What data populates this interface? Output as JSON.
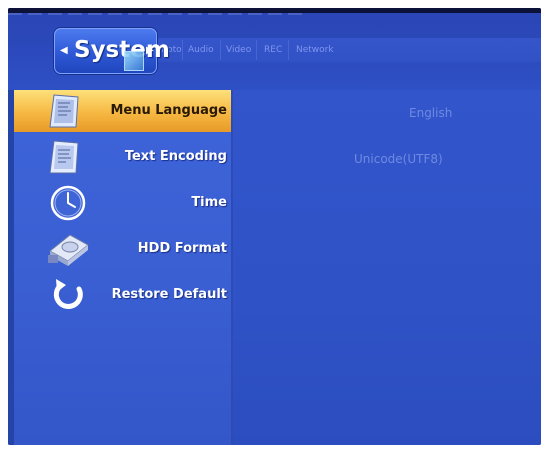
{
  "header": {
    "active_tab": "System",
    "tabs": [
      "Photo",
      "Audio",
      "Video",
      "REC",
      "Network"
    ]
  },
  "menu": {
    "items": [
      {
        "label": "Menu Language",
        "icon": "menu-language-icon",
        "value": "English",
        "selected": true
      },
      {
        "label": "Text Encoding",
        "icon": "text-encoding-icon",
        "value": "Unicode(UTF8)"
      },
      {
        "label": "Time",
        "icon": "clock-icon"
      },
      {
        "label": "HDD Format",
        "icon": "hdd-icon"
      },
      {
        "label": "Restore Default",
        "icon": "restore-icon"
      }
    ]
  },
  "colors": {
    "highlight": "#f6b842",
    "background": "#3a5fd3"
  }
}
